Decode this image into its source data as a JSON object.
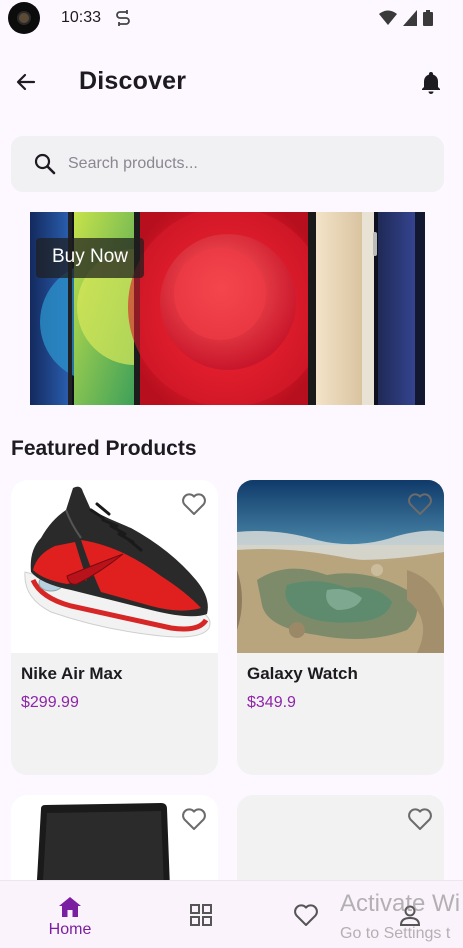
{
  "status_bar": {
    "time": "10:33"
  },
  "app_bar": {
    "title": "Discover"
  },
  "search": {
    "placeholder": "Search products...",
    "value": ""
  },
  "banner": {
    "button_label": "Buy Now"
  },
  "featured": {
    "title": "Featured Products",
    "products": [
      {
        "name": "Nike Air Max",
        "price": "$299.99"
      },
      {
        "name": "Galaxy Watch",
        "price": "$349.9"
      }
    ]
  },
  "bottom_nav": {
    "items": [
      {
        "label": "Home",
        "icon": "home-icon"
      },
      {
        "label": "",
        "icon": "grid-icon"
      },
      {
        "label": "",
        "icon": "heart-icon"
      },
      {
        "label": "",
        "icon": "person-icon"
      }
    ]
  },
  "watermark": {
    "line1": "Activate Wi",
    "line2": "Go to Settings t"
  },
  "colors": {
    "accent": "#7b1fa2",
    "price": "#8e24aa",
    "background": "#fdf7ff"
  }
}
